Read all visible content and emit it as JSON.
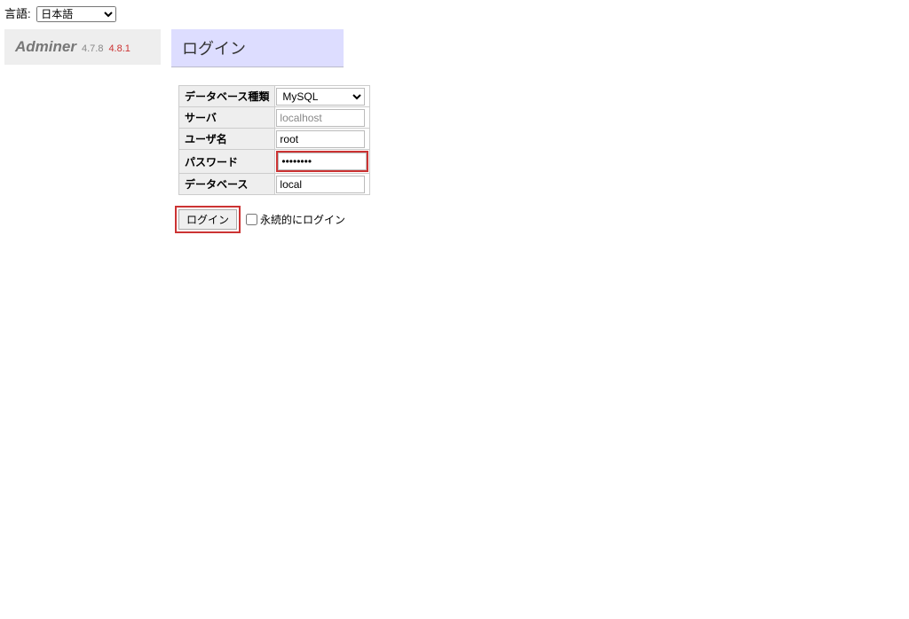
{
  "lang": {
    "label": "言語:",
    "selected": "日本語"
  },
  "app": {
    "name": "Adminer",
    "version": "4.7.8",
    "new_version": "4.8.1"
  },
  "title": "ログイン",
  "form": {
    "system": {
      "label": "データベース種類",
      "value": "MySQL"
    },
    "server": {
      "label": "サーバ",
      "placeholder": "localhost",
      "value": ""
    },
    "username": {
      "label": "ユーザ名",
      "value": "root"
    },
    "password": {
      "label": "パスワード",
      "value": "••••••••"
    },
    "database": {
      "label": "データベース",
      "value": "local"
    }
  },
  "buttons": {
    "login": "ログイン",
    "permanent": "永続的にログイン"
  }
}
